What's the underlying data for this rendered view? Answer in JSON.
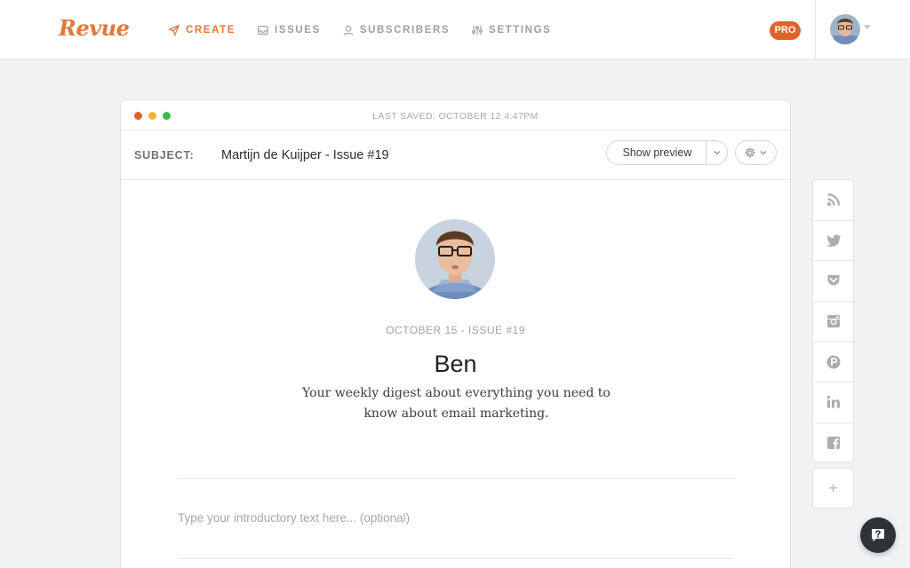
{
  "brand": {
    "logo": "Revue",
    "accent": "#e2773a"
  },
  "nav": {
    "items": [
      {
        "label": "Create",
        "icon": "paper-plane-icon",
        "active": true
      },
      {
        "label": "Issues",
        "icon": "inbox-icon",
        "active": false
      },
      {
        "label": "Subscribers",
        "icon": "user-icon",
        "active": false
      },
      {
        "label": "Settings",
        "icon": "sliders-icon",
        "active": false
      }
    ],
    "badge": "PRO"
  },
  "editor": {
    "last_saved": "LAST SAVED: OCTOBER 12 4:47PM",
    "subject_label": "SUBJECT:",
    "subject_value": "Martijn de Kuijper - Issue #19",
    "preview_label": "Show preview",
    "issue_meta": "OCTOBER 15 - ISSUE #19",
    "name": "Ben",
    "description": "Your weekly digest about everything you need to know about email marketing.",
    "intro_placeholder": "Type your introductory text here... (optional)"
  },
  "social": {
    "items": [
      "rss-icon",
      "twitter-icon",
      "pocket-icon",
      "instagram-icon",
      "producthunt-icon",
      "linkedin-icon",
      "facebook-icon"
    ],
    "add": "+"
  }
}
